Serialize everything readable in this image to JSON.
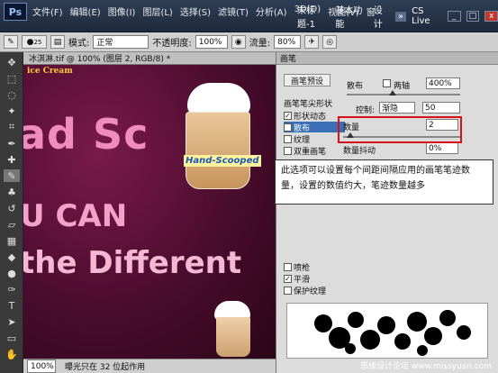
{
  "app": {
    "logo": "Ps",
    "menus": [
      "文件(F)",
      "编辑(E)",
      "图像(I)",
      "图层(L)",
      "选择(S)",
      "滤镜(T)",
      "分析(A)",
      "3D(D)",
      "视图(V)",
      "窗"
    ],
    "right_items": [
      "未标题-1",
      "基本功能",
      "设计",
      "CS Live"
    ],
    "window_controls": [
      "_",
      "□",
      "x"
    ]
  },
  "options_bar": {
    "brush_size": "25",
    "mode_label": "模式:",
    "mode_value": "正常",
    "opacity_label": "不透明度:",
    "opacity_value": "100%",
    "flow_label": "流量:",
    "flow_value": "80%"
  },
  "document": {
    "tab_title": "冰淇淋.tif @ 100% (图层 2, RGB/8) *",
    "zoom": "100%",
    "status_text": "曝光只在 32 位起作用",
    "art_text": {
      "top": "ice Cream",
      "line1": "ad Sc",
      "line2": "U CAN",
      "line3": "the Different",
      "cup_brand": "Hand-Scooped"
    }
  },
  "panel": {
    "tab": "画笔",
    "preset_button": "画笔预设",
    "tip_shape": "画笔笔尖形状",
    "items": [
      {
        "label": "形状动态",
        "checked": true
      },
      {
        "label": "散布",
        "checked": true,
        "selected": true
      },
      {
        "label": "纹理",
        "checked": false
      },
      {
        "label": "双重画笔",
        "checked": false
      },
      {
        "label": "喷枪",
        "checked": false
      },
      {
        "label": "平滑",
        "checked": true
      },
      {
        "label": "保护纹理",
        "checked": false
      }
    ],
    "scatter_label": "散布",
    "both_axes_label": "两轴",
    "scatter_value": "400%",
    "control_label": "控制:",
    "control_value": "渐隐",
    "control_amount": "50",
    "count_label": "数量",
    "count_value": "2",
    "count_jitter_label": "数量抖动",
    "count_jitter_value": "0%"
  },
  "callout": {
    "text": "此选项可以设置每个间距间隔应用的画笔笔迹数量，设置的数值约大，笔迹数量越多"
  },
  "watermark": "思缘设计论坛 www.missyuan.com",
  "chart_data": null
}
